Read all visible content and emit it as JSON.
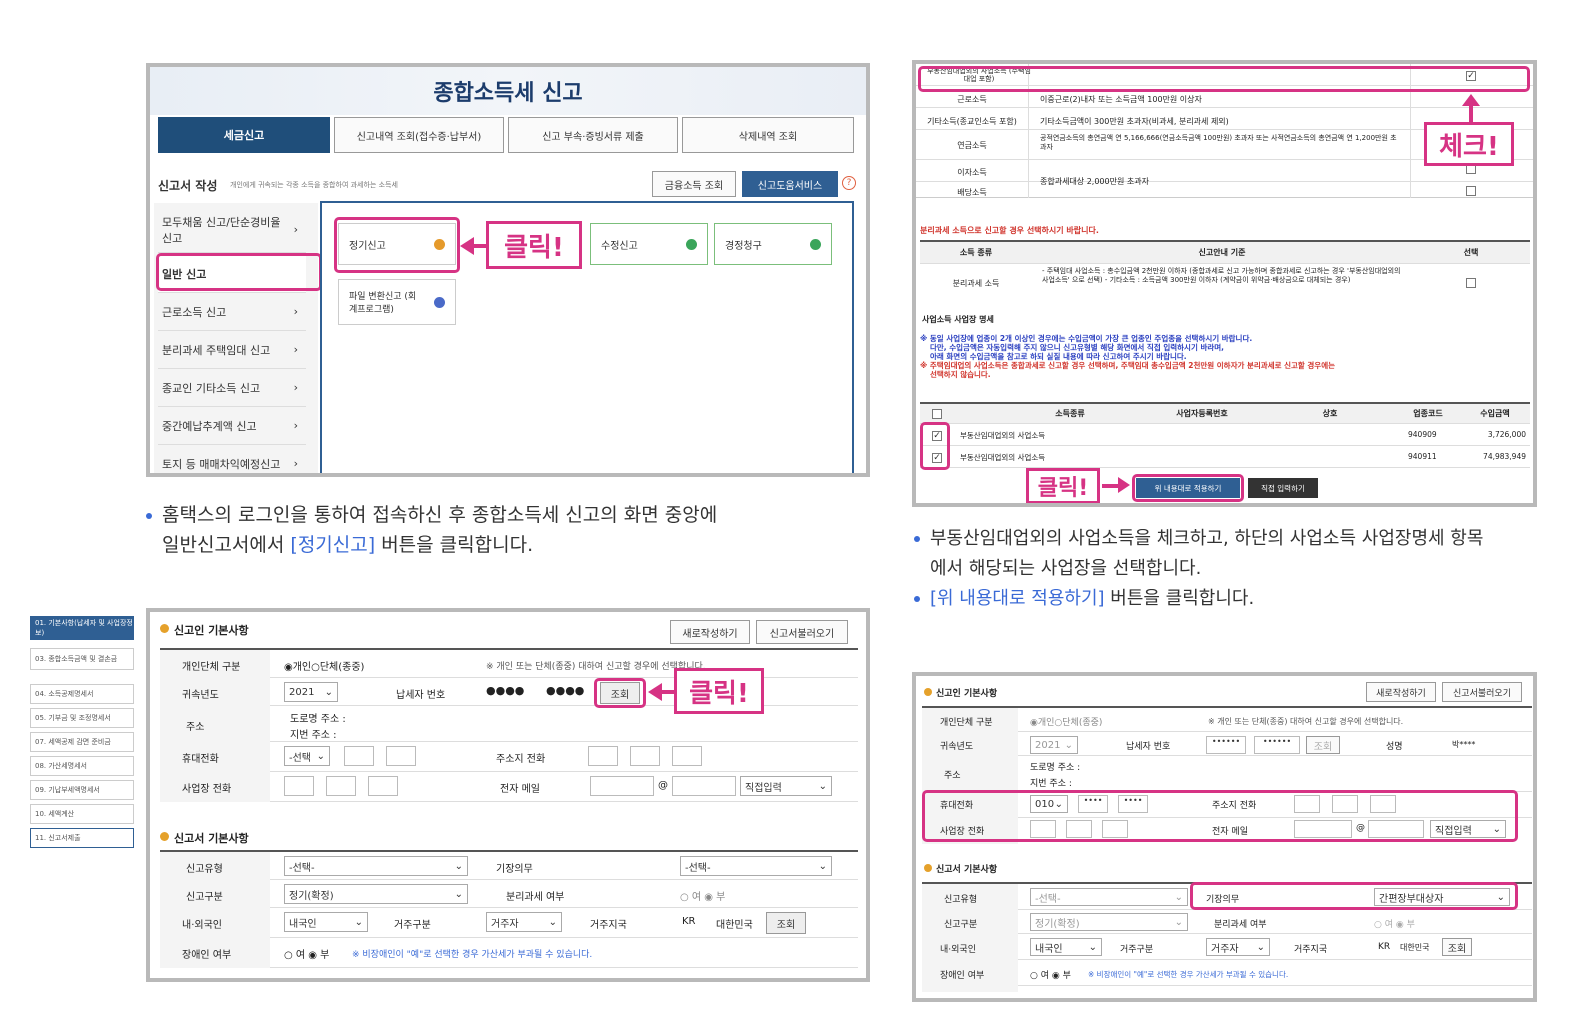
{
  "p1": {
    "title": "종합소득세 신고",
    "tabs": [
      "세금신고",
      "신고내역 조회(접수증·납부서)",
      "신고 부속·증빙서류 제출",
      "삭제내역 조회"
    ],
    "section_title": "신고서 작성",
    "section_desc": "개인에게 귀속되는 각종 소득을 종합하여 과세하는 소득세",
    "btn_finance": "금융소득 조회",
    "btn_help": "신고도움서비스",
    "side": [
      "모두채움 신고/단순경비율 신고",
      "일반 신고",
      "근로소득 신고",
      "분리과세 주택임대 신고",
      "종교인 기타소득 신고",
      "중간예납추계액 신고",
      "토지 등 매매차익예정신고"
    ],
    "grid": [
      "정기신고",
      "수정신고",
      "경정청구"
    ],
    "file_btn": "파일 변환신고 (회계프로그램)",
    "callout": "클릭!",
    "caption1": "홈택스의 로그인을 통하여 접속하신 후 종합소득세 신고의 화면 중앙에",
    "caption2_pre": "일반신고서에서 ",
    "caption2_hl": "[정기신고]",
    "caption2_post": " 버튼을 클릭합니다."
  },
  "p2": {
    "rows": [
      {
        "a": "부동산임대업외의 사업소득 (주택임대업 포함)",
        "b": ""
      },
      {
        "a": "근로소득",
        "b": "이중근로(2)내자 또는 소득금액 100만원 이상자"
      },
      {
        "a": "기타소득(종교인소득 포함)",
        "b": "기타소득금액이 300만원 초과자(비과세, 분리과세 제외)"
      },
      {
        "a": "연금소득",
        "b": "공적연금소득의 총연금액 연 5,166,666(연금소득금액 100만원) 초과자 또는 사적연금소득의 총연금액 연 1,200만원 초과자"
      },
      {
        "a": "이자소득",
        "b": "종합과세대상 2,000만원 초과자"
      },
      {
        "a": "배당소득",
        "b": ""
      }
    ],
    "check_callout": "체크!",
    "note_red": "분리과세 소득으로 신고할 경우 선택하시기 바랍니다.",
    "th": [
      "소득 종류",
      "신고안내 기준",
      "선택"
    ],
    "sep_row_a": "분리과세 소득",
    "sep_row_b": "- 주택임대 사업소득 : 총수입금액 2천만원 이하자 (종합과세로 신고 가능하며 종합과세로 신고하는 경우 '부동산임대업외의 사업소득' 으로 선택) - 기타소득 : 소득금액 300만원 이하자 (계약금이 위약금·배상금으로 대체되는 경우)",
    "biz_title": "사업소득 사업장 명세",
    "notes": [
      "※ 동일 사업장에 업종이 2개 이상인 경우에는 수입금액이 가장 큰 업종인 주업종을 선택하시기 바랍니다.",
      "다만, 수입금액은 자동입력해 주지 않으니 신고유형별 해당 화면에서 직접 입력하시기 바라며,",
      "아래 화면의 수입금액을 참고로 하되 실질 내용에 따라 신고하여 주시기 바랍니다.",
      "※ 주택임대업의 사업소득은 종합과세로 신고할 경우 선택하며, 주택임대 총수입금액 2천만원 이하자가 분리과세로 신고할 경우에는",
      "선택하지 않습니다."
    ],
    "th2": [
      "소득종류",
      "사업자등록번호",
      "상호",
      "업종코드",
      "수입금액"
    ],
    "items": [
      {
        "kind": "부동산임대업외의 사업소득",
        "code": "940909",
        "amt": "3,726,000"
      },
      {
        "kind": "부동산임대업외의 사업소득",
        "code": "940911",
        "amt": "74,983,949"
      }
    ],
    "apply_btn": "위 내용대로 적용하기",
    "direct_btn": "직접 입력하기",
    "click": "클릭!",
    "cap1": "부동산임대업외의 사업소득을 체크하고, 하단의 사업소득 사업장명세 항목",
    "cap2": "에서 해당되는 사업장을 선택합니다.",
    "cap3_hl": "[위 내용대로 적용하기]",
    "cap3_post": " 버튼을 클릭합니다."
  },
  "p3": {
    "nav": [
      "01. 기본사항(납세자 및 사업장정보)",
      "03. 종합소득금액 및 결손금",
      "04. 소득공제명세서",
      "05. 기부금 및 조정명세서",
      "07. 세액공제 감면 준비금",
      "08. 가산세명세서",
      "09. 기납부세액명세서",
      "10. 세액계산",
      "11. 신고서제출"
    ],
    "h1": "신고인 기본사항",
    "new_btn": "새로작성하기",
    "load_btn": "신고서불러오기",
    "indiv": "개인단체 구분",
    "indiv_val": "◉개인○단체(종중)",
    "indiv_note": "※ 개인 또는 단체(종중) 대하여 신고할 경우에 선택합니다.",
    "year": "귀속년도",
    "year_val": "2021",
    "taxpayer": "납세자 번호",
    "mask": "●●●●",
    "lookup": "조회",
    "addr": "주소",
    "road": "도로명 주소 :",
    "lot": "지번 주소 :",
    "mobile": "휴대전화",
    "mobile_sel": "-선택",
    "home_tel": "주소지 전화",
    "biz_tel": "사업장 전화",
    "email": "전자 메일",
    "direct": "직접입력",
    "h2": "신고서 기본사항",
    "type": "신고유형",
    "type_val": "-선택-",
    "bookkeeping": "기장의무",
    "book_val": "-선택-",
    "kind": "신고구분",
    "kind_val": "정기(확정)",
    "sep_tax": "분리과세 여부",
    "sep_val": "○ 여 ◉ 부",
    "nation": "내·외국인",
    "nation_val": "내국인",
    "resid": "거주구분",
    "resid_val": "거주자",
    "country": "거주지국",
    "kr": "KR",
    "korea": "대한민국",
    "disabled": "장애인 여부",
    "dis_val": "○ 여 ◉ 부",
    "dis_note": "※ 비장애인이 \"예\"로 선택한 경우 가산세가 부과될 수 있습니다.",
    "click": "클릭!"
  },
  "p4": {
    "h1": "신고인 기본사항",
    "new_btn": "새로작성하기",
    "load_btn": "신고서불러오기",
    "indiv": "개인단체 구분",
    "indiv_val": "◉개인○단체(종중)",
    "indiv_note": "※ 개인 또는 단체(종중) 대하여 신고할 경우에 선택합니다.",
    "year": "귀속년도",
    "year_val": "2021",
    "taxpayer": "납세자 번호",
    "mask": "••••••",
    "lookup": "조회",
    "name": "성명",
    "name_val": "박****",
    "addr": "주소",
    "road": "도로명 주소 :",
    "lot": "지번 주소 :",
    "mobile": "휴대전화",
    "mob1": "010",
    "mob2": "••••",
    "mob3": "••••",
    "home_tel": "주소지 전화",
    "biz_tel": "사업장 전화",
    "email": "전자 메일",
    "direct": "직접입력",
    "h2": "신고서 기본사항",
    "type": "신고유형",
    "type_val": "-선택-",
    "bookkeeping": "기장의무",
    "book_val": "간편장부대상자",
    "kind": "신고구분",
    "kind_val": "정기(확정)",
    "sep_tax": "분리과세 여부",
    "sep_val": "○ 여 ◉ 부",
    "nation": "내·외국인",
    "nation_val": "내국인",
    "resid": "거주구분",
    "resid_val": "거주자",
    "country": "거주지국",
    "kr": "KR",
    "korea": "대한민국",
    "disabled": "장애인 여부",
    "dis_val": "○ 여 ◉ 부",
    "dis_note": "※ 비장애인이 \"예\"로 선택한 경우 가산세가 부과될 수 있습니다."
  }
}
